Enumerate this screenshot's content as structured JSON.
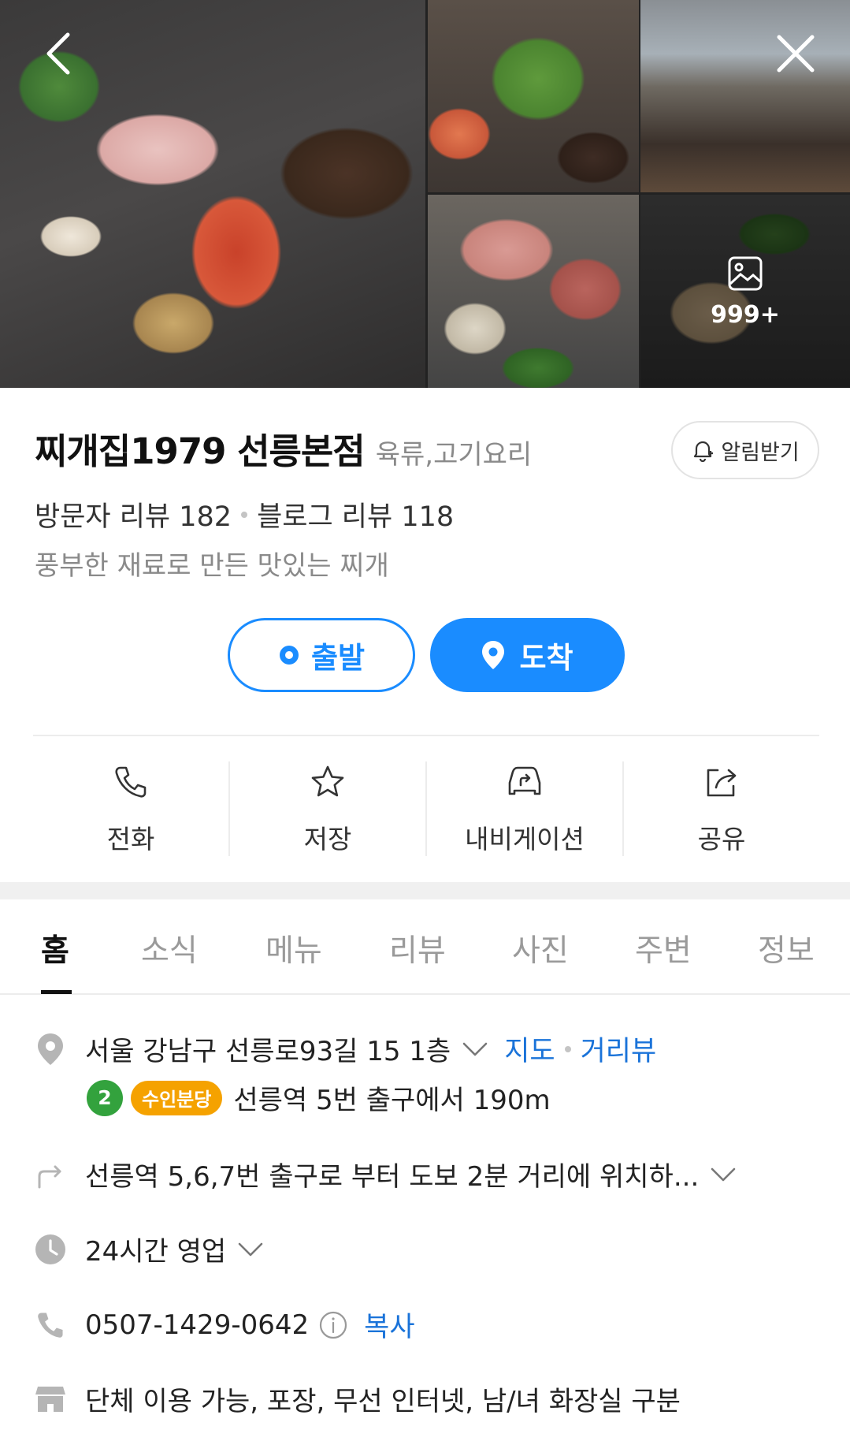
{
  "gallery": {
    "photo_more_count": "999+"
  },
  "place": {
    "name": "찌개집1979 선릉본점",
    "category": "육류,고기요리",
    "alarm_label": "알림받기",
    "visitor_review_label": "방문자 리뷰 182",
    "blog_review_label": "블로그 리뷰 118",
    "description": "풍부한 재료로 만든 맛있는 찌개"
  },
  "route": {
    "start_label": "출발",
    "arrive_label": "도착"
  },
  "actions": [
    {
      "label": "전화",
      "icon": "phone-icon"
    },
    {
      "label": "저장",
      "icon": "star-icon"
    },
    {
      "label": "내비게이션",
      "icon": "car-navigation-icon"
    },
    {
      "label": "공유",
      "icon": "share-icon"
    }
  ],
  "tabs": [
    {
      "label": "홈",
      "active": true
    },
    {
      "label": "소식"
    },
    {
      "label": "메뉴"
    },
    {
      "label": "리뷰"
    },
    {
      "label": "사진"
    },
    {
      "label": "주변"
    },
    {
      "label": "정보"
    }
  ],
  "details": {
    "address": "서울 강남구 선릉로93길 15 1층",
    "map_link": "지도",
    "street_view_link": "거리뷰",
    "subway_line": "2",
    "subway_line_name": "수인분당",
    "subway_directions": "선릉역 5번 출구에서 190m",
    "directions": "선릉역 5,6,7번 출구로 부터 도보 2분 거리에 위치하...",
    "hours": "24시간 영업",
    "phone": "0507-1429-0642",
    "copy_label": "복사",
    "amenities": "단체 이용 가능, 포장, 무선 인터넷, 남/녀 화장실 구분"
  },
  "colors": {
    "accent_blue": "#1a8cff",
    "link_blue": "#1a73d9",
    "line2_green": "#33a23d",
    "suin_bundang_yellow": "#f5a200"
  }
}
